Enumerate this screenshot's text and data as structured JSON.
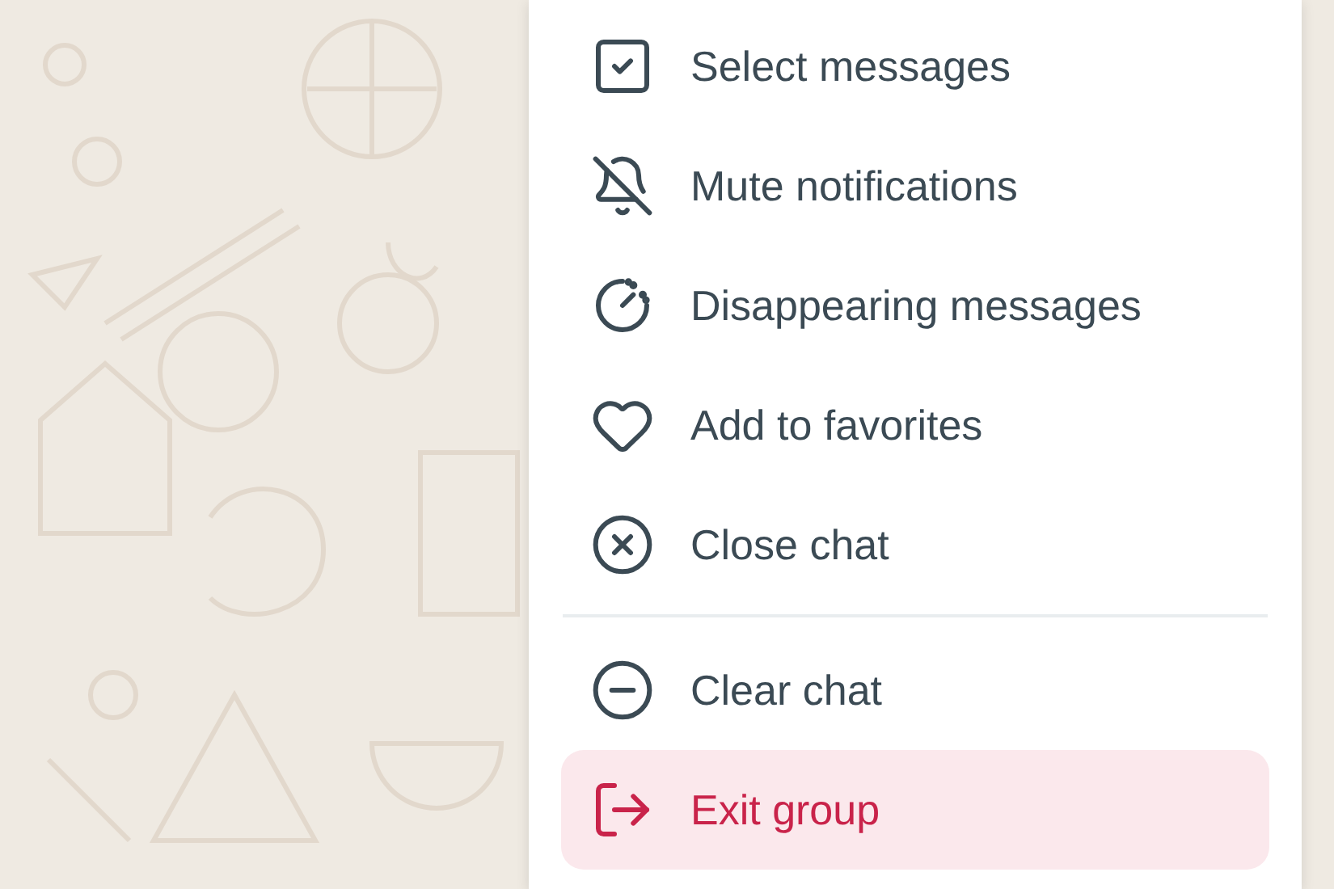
{
  "menu": {
    "sections": [
      {
        "items": [
          {
            "label": "Select messages",
            "kind": "normal",
            "highlighted": false
          },
          {
            "label": "Mute notifications",
            "kind": "normal",
            "highlighted": false
          },
          {
            "label": "Disappearing messages",
            "kind": "normal",
            "highlighted": false
          },
          {
            "label": "Add to favorites",
            "kind": "normal",
            "highlighted": false
          },
          {
            "label": "Close chat",
            "kind": "normal",
            "highlighted": false
          }
        ]
      },
      {
        "items": [
          {
            "label": "Clear chat",
            "kind": "normal",
            "highlighted": false
          },
          {
            "label": "Exit group",
            "kind": "danger",
            "highlighted": true
          }
        ]
      }
    ]
  }
}
